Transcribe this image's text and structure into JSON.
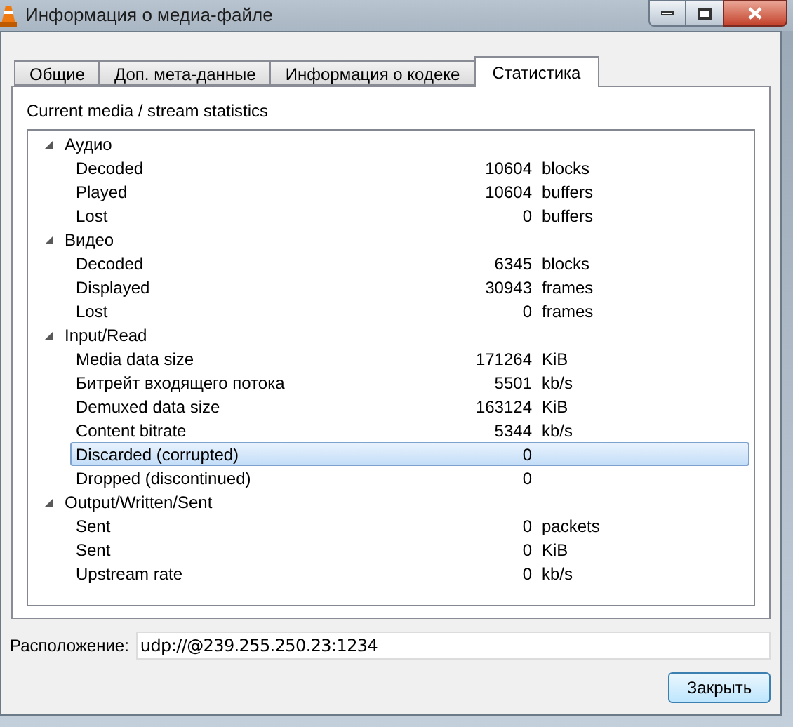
{
  "window": {
    "title": "Информация о медиа-файле"
  },
  "tabs": [
    {
      "label": "Общие",
      "selected": false
    },
    {
      "label": "Доп. мета-данные",
      "selected": false
    },
    {
      "label": "Информация о кодеке",
      "selected": false
    },
    {
      "label": "Статистика",
      "selected": true
    }
  ],
  "panel_title": "Current media / stream statistics",
  "tree": [
    {
      "label": "Аудио",
      "expanded": true,
      "children": [
        {
          "name": "Decoded",
          "value": "10604",
          "unit": "blocks",
          "selected": false
        },
        {
          "name": "Played",
          "value": "10604",
          "unit": "buffers",
          "selected": false
        },
        {
          "name": "Lost",
          "value": "0",
          "unit": "buffers",
          "selected": false
        }
      ]
    },
    {
      "label": "Видео",
      "expanded": true,
      "children": [
        {
          "name": "Decoded",
          "value": "6345",
          "unit": "blocks",
          "selected": false
        },
        {
          "name": "Displayed",
          "value": "30943",
          "unit": "frames",
          "selected": false
        },
        {
          "name": "Lost",
          "value": "0",
          "unit": "frames",
          "selected": false
        }
      ]
    },
    {
      "label": "Input/Read",
      "expanded": true,
      "children": [
        {
          "name": "Media data size",
          "value": "171264",
          "unit": "KiB",
          "selected": false
        },
        {
          "name": "Битрейт входящего потока",
          "value": "5501",
          "unit": "kb/s",
          "selected": false
        },
        {
          "name": "Demuxed data size",
          "value": "163124",
          "unit": "KiB",
          "selected": false
        },
        {
          "name": "Content bitrate",
          "value": "5344",
          "unit": "kb/s",
          "selected": false
        },
        {
          "name": "Discarded (corrupted)",
          "value": "0",
          "selected": true
        },
        {
          "name": "Dropped (discontinued)",
          "value": "0",
          "selected": false
        }
      ]
    },
    {
      "label": "Output/Written/Sent",
      "expanded": true,
      "children": [
        {
          "name": "Sent",
          "value": "0",
          "unit": "packets",
          "selected": false
        },
        {
          "name": "Sent",
          "value": "0",
          "unit": "KiB",
          "selected": false
        },
        {
          "name": "Upstream rate",
          "value": "0",
          "unit": "kb/s",
          "selected": false
        }
      ]
    }
  ],
  "location": {
    "label": "Расположение:",
    "value": "udp://@239.255.250.23:1234"
  },
  "buttons": [
    "Закрыть"
  ]
}
